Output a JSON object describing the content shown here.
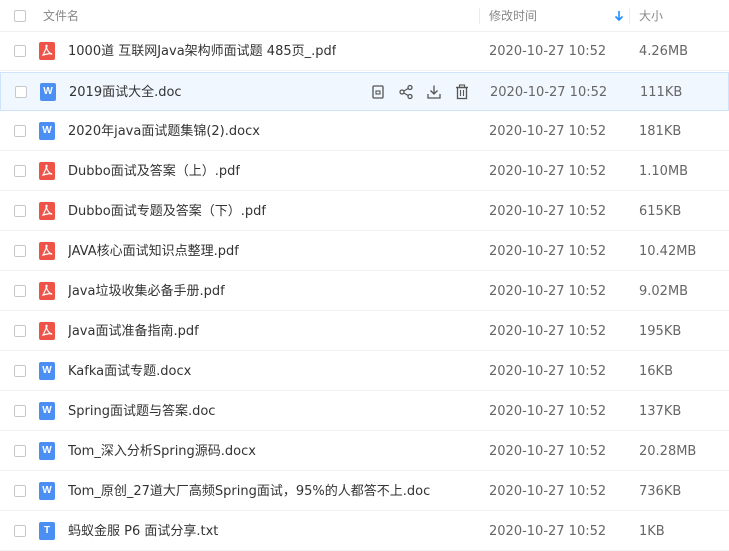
{
  "header": {
    "name_label": "文件名",
    "date_label": "修改时间",
    "size_label": "大小",
    "sort_icon": "arrow-down-icon"
  },
  "colors": {
    "pdf_icon": "#ee5347",
    "doc_icon": "#4c8ff2",
    "sort_arrow": "#1f8dff",
    "hover_row": "#f0f7ff"
  },
  "hover_actions": [
    "copy-icon",
    "share-icon",
    "download-icon",
    "delete-icon"
  ],
  "files": [
    {
      "type": "pdf",
      "icon": "pdf-file-icon",
      "name": "1000道 互联网Java架构师面试题 485页_.pdf",
      "date": "2020-10-27 10:52",
      "size": "4.26MB"
    },
    {
      "type": "doc",
      "icon": "word-file-icon",
      "name": "2019面试大全.doc",
      "date": "2020-10-27 10:52",
      "size": "111KB",
      "hover": true
    },
    {
      "type": "doc",
      "icon": "word-file-icon",
      "name": "2020年java面试题集锦(2).docx",
      "date": "2020-10-27 10:52",
      "size": "181KB"
    },
    {
      "type": "pdf",
      "icon": "pdf-file-icon",
      "name": "Dubbo面试及答案（上）.pdf",
      "date": "2020-10-27 10:52",
      "size": "1.10MB"
    },
    {
      "type": "pdf",
      "icon": "pdf-file-icon",
      "name": "Dubbo面试专题及答案（下）.pdf",
      "date": "2020-10-27 10:52",
      "size": "615KB"
    },
    {
      "type": "pdf",
      "icon": "pdf-file-icon",
      "name": "JAVA核心面试知识点整理.pdf",
      "date": "2020-10-27 10:52",
      "size": "10.42MB"
    },
    {
      "type": "pdf",
      "icon": "pdf-file-icon",
      "name": "Java垃圾收集必备手册.pdf",
      "date": "2020-10-27 10:52",
      "size": "9.02MB"
    },
    {
      "type": "pdf",
      "icon": "pdf-file-icon",
      "name": "Java面试准备指南.pdf",
      "date": "2020-10-27 10:52",
      "size": "195KB"
    },
    {
      "type": "doc",
      "icon": "word-file-icon",
      "name": "Kafka面试专题.docx",
      "date": "2020-10-27 10:52",
      "size": "16KB"
    },
    {
      "type": "doc",
      "icon": "word-file-icon",
      "name": "Spring面试题与答案.doc",
      "date": "2020-10-27 10:52",
      "size": "137KB"
    },
    {
      "type": "doc",
      "icon": "word-file-icon",
      "name": "Tom_深入分析Spring源码.docx",
      "date": "2020-10-27 10:52",
      "size": "20.28MB"
    },
    {
      "type": "doc",
      "icon": "word-file-icon",
      "name": "Tom_原创_27道大厂高频Spring面试，95%的人都答不上.doc",
      "date": "2020-10-27 10:52",
      "size": "736KB"
    },
    {
      "type": "txt",
      "icon": "text-file-icon",
      "name": "蚂蚁金服 P6 面试分享.txt",
      "date": "2020-10-27 10:52",
      "size": "1KB"
    }
  ]
}
